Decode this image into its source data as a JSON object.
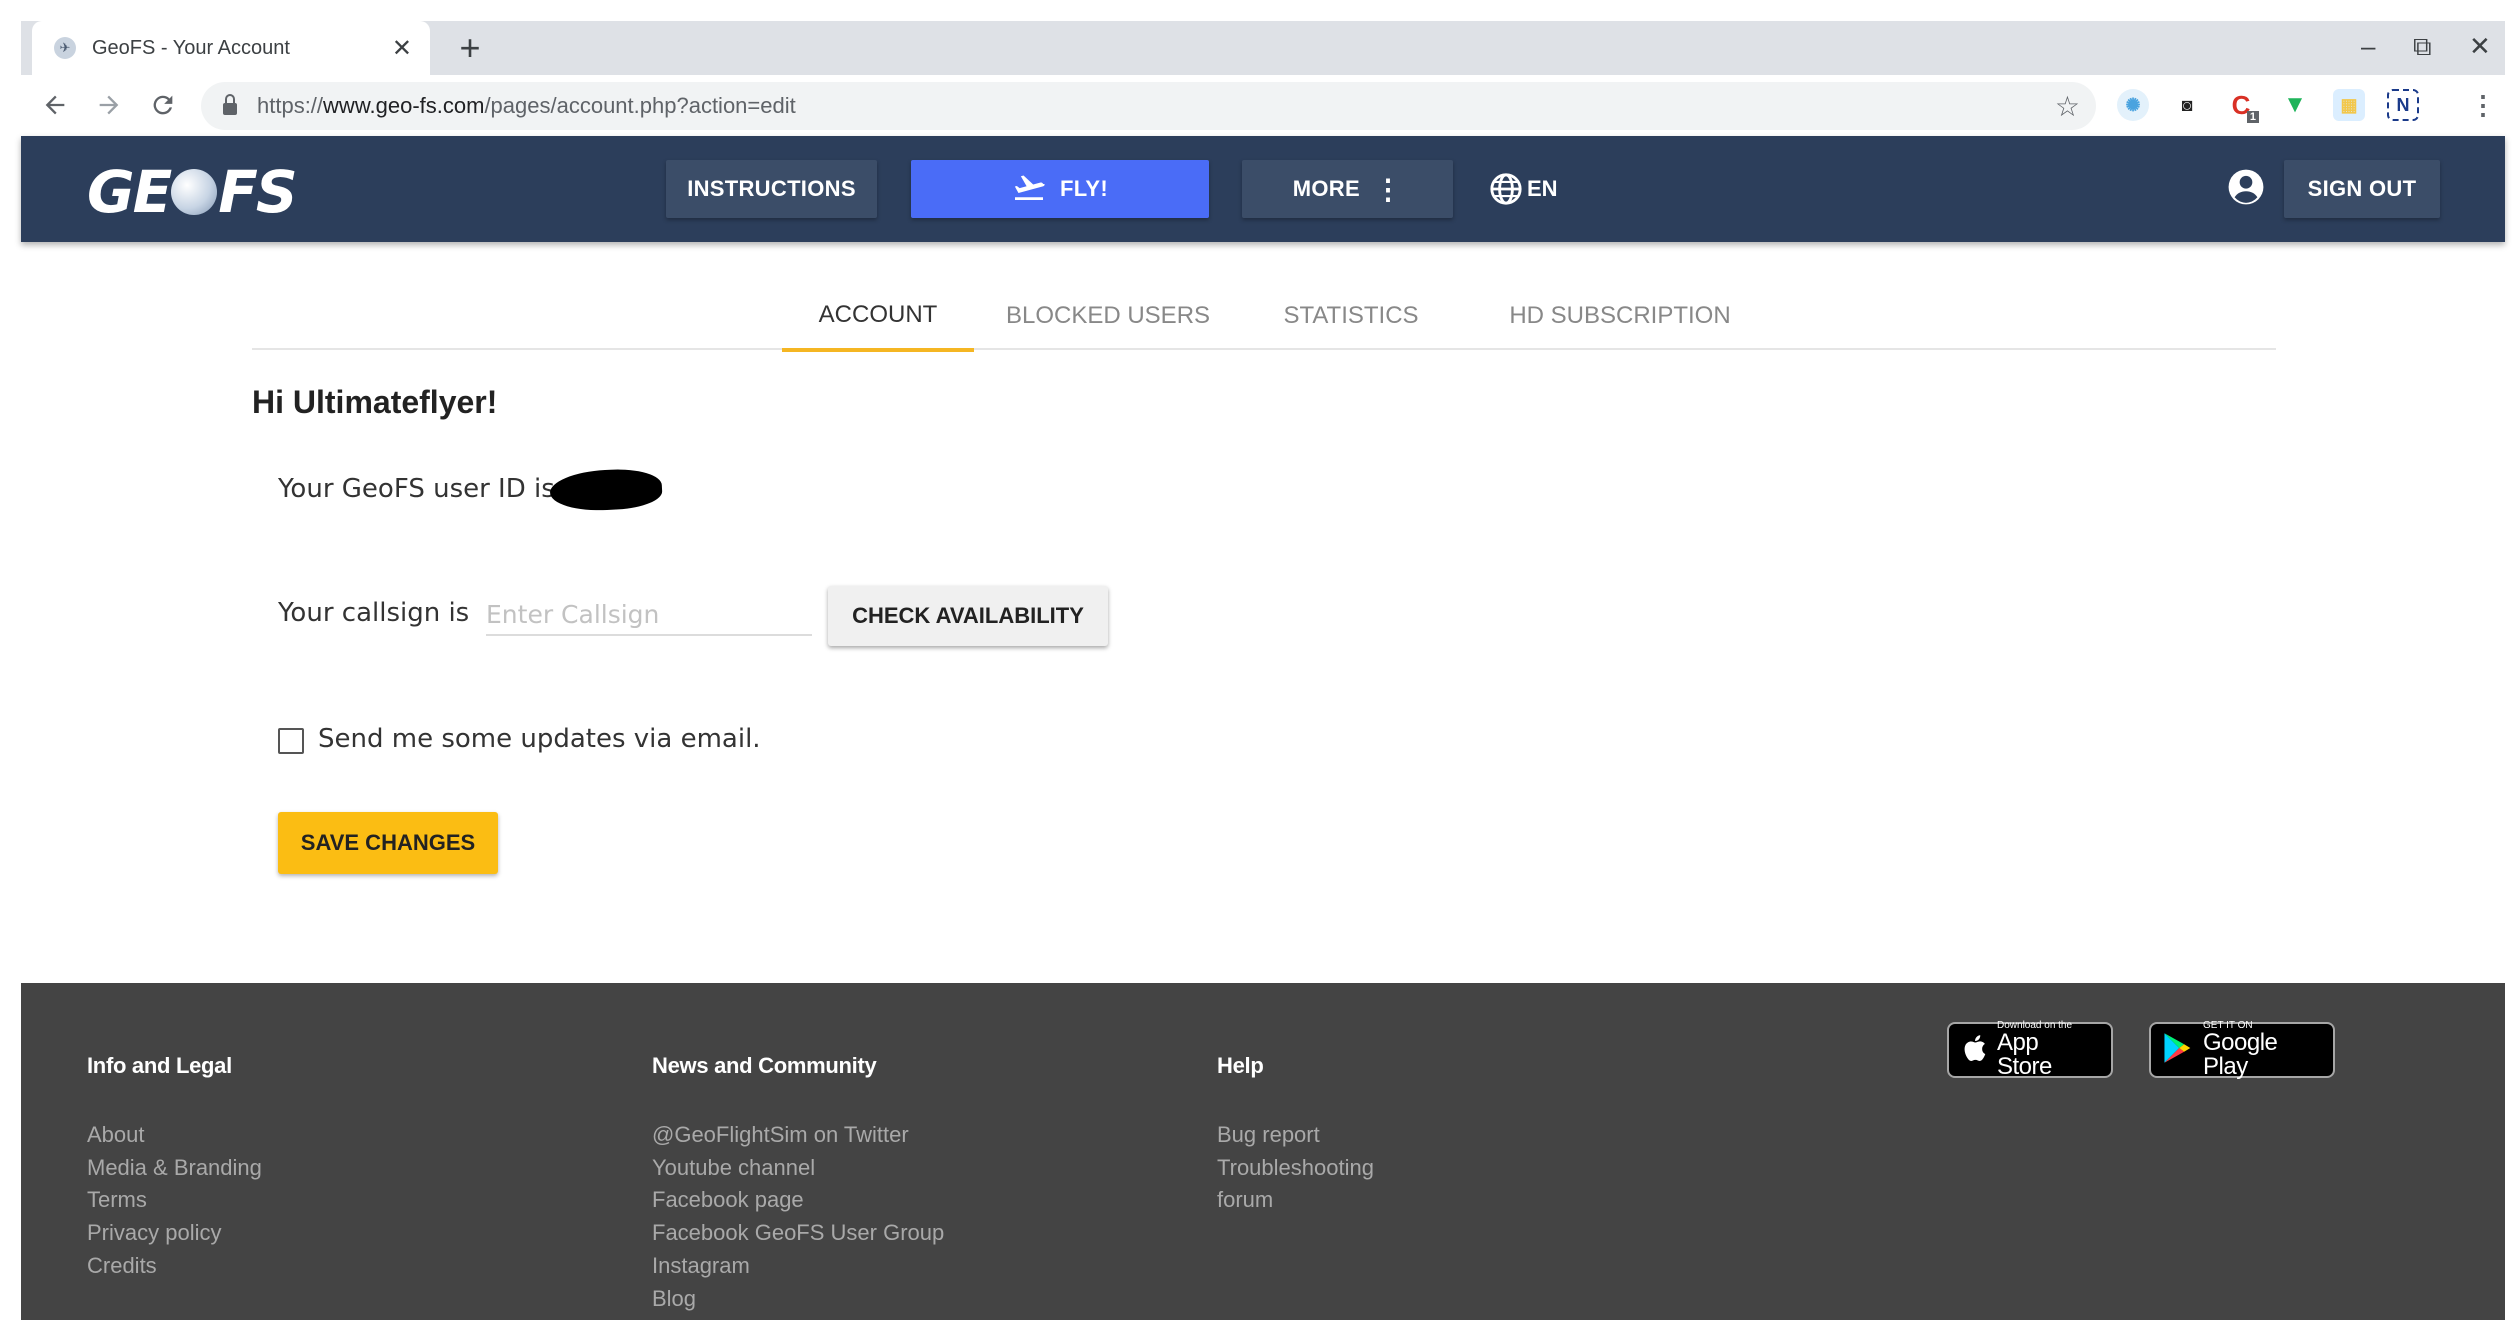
{
  "browser": {
    "tab_title": "GeoFS - Your Account",
    "tab_close": "✕",
    "new_tab": "+",
    "url_prefix": "https://",
    "url_host": "www.geo-fs.com",
    "url_path": "/pages/account.php?action=edit",
    "window_minimize": "–",
    "window_restore": "⧉",
    "window_close": "✕",
    "ext_badge": "1"
  },
  "header": {
    "logo_left": "GE",
    "logo_right": "FS",
    "instructions": "INSTRUCTIONS",
    "fly": "FLY!",
    "more": "MORE",
    "language": "EN",
    "sign_out": "SIGN OUT"
  },
  "tabs": [
    {
      "label": "ACCOUNT",
      "active": true
    },
    {
      "label": "BLOCKED USERS",
      "active": false
    },
    {
      "label": "STATISTICS",
      "active": false
    },
    {
      "label": "HD SUBSCRIPTION",
      "active": false
    }
  ],
  "content": {
    "greeting": "Hi Ultimateflyer!",
    "user_id_text": "Your GeoFS user ID is",
    "callsign_label": "Your callsign is",
    "callsign_placeholder": "Enter Callsign",
    "callsign_value": "",
    "check_button": "CHECK AVAILABILITY",
    "email_updates_label": "Send me some updates via email.",
    "email_updates_checked": false,
    "save_button": "SAVE CHANGES"
  },
  "footer": {
    "columns": [
      {
        "heading": "Info and Legal",
        "links": [
          "About",
          "Media & Branding",
          "Terms",
          "Privacy policy",
          "Credits"
        ]
      },
      {
        "heading": "News and Community",
        "links": [
          "@GeoFlightSim on Twitter",
          "Youtube channel",
          "Facebook page",
          "Facebook GeoFS User Group",
          "Instagram",
          "Blog"
        ]
      },
      {
        "heading": "Help",
        "links": [
          "Bug report",
          "Troubleshooting",
          "forum"
        ]
      }
    ],
    "app_store": {
      "small": "Download on the",
      "big": "App Store"
    },
    "google_play": {
      "small": "GET IT ON",
      "big": "Google Play"
    }
  },
  "colors": {
    "header_bg": "#2c3e5b",
    "fly_button": "#4a6cf7",
    "save_button": "#fbbd13",
    "tab_underline": "#f5b623",
    "footer_bg": "#444444"
  }
}
